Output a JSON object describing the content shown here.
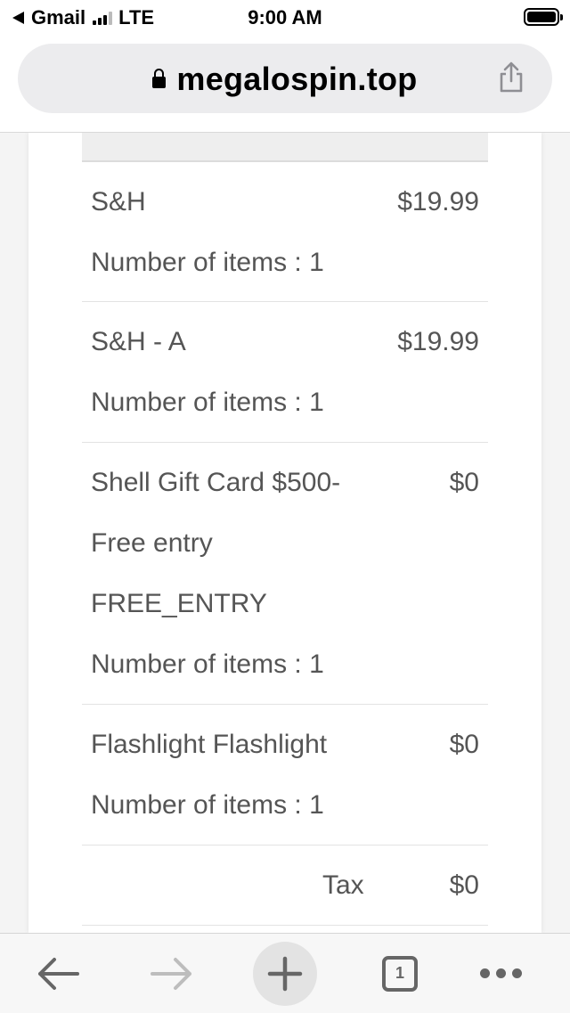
{
  "status_bar": {
    "back_app": "Gmail",
    "network": "LTE",
    "time": "9:00 AM"
  },
  "browser": {
    "url": "megalospin.top",
    "open_tabs": "1"
  },
  "order_items": [
    {
      "name": "S&H",
      "price": "$19.99",
      "details": [
        "Number of items : 1"
      ]
    },
    {
      "name": "S&H - A",
      "price": "$19.99",
      "details": [
        "Number of items : 1"
      ]
    },
    {
      "name": "Shell Gift Card $500-",
      "price": "$0",
      "details": [
        "Free entry",
        "FREE_ENTRY",
        "Number of items : 1"
      ]
    },
    {
      "name": "Flashlight Flashlight",
      "price": "$0",
      "details": [
        "Number of items : 1"
      ]
    }
  ],
  "tax": {
    "label": "Tax",
    "value": "$0"
  },
  "colors": {
    "text": "#555555",
    "url_bar": "#ececee",
    "toolbar_icon": "#666666"
  },
  "icons": [
    "back-arrow-icon",
    "forward-arrow-icon",
    "new-tab-plus-icon",
    "tabs-count-icon",
    "more-dots-icon",
    "share-icon",
    "lock-icon",
    "battery-icon",
    "signal-icon"
  ]
}
